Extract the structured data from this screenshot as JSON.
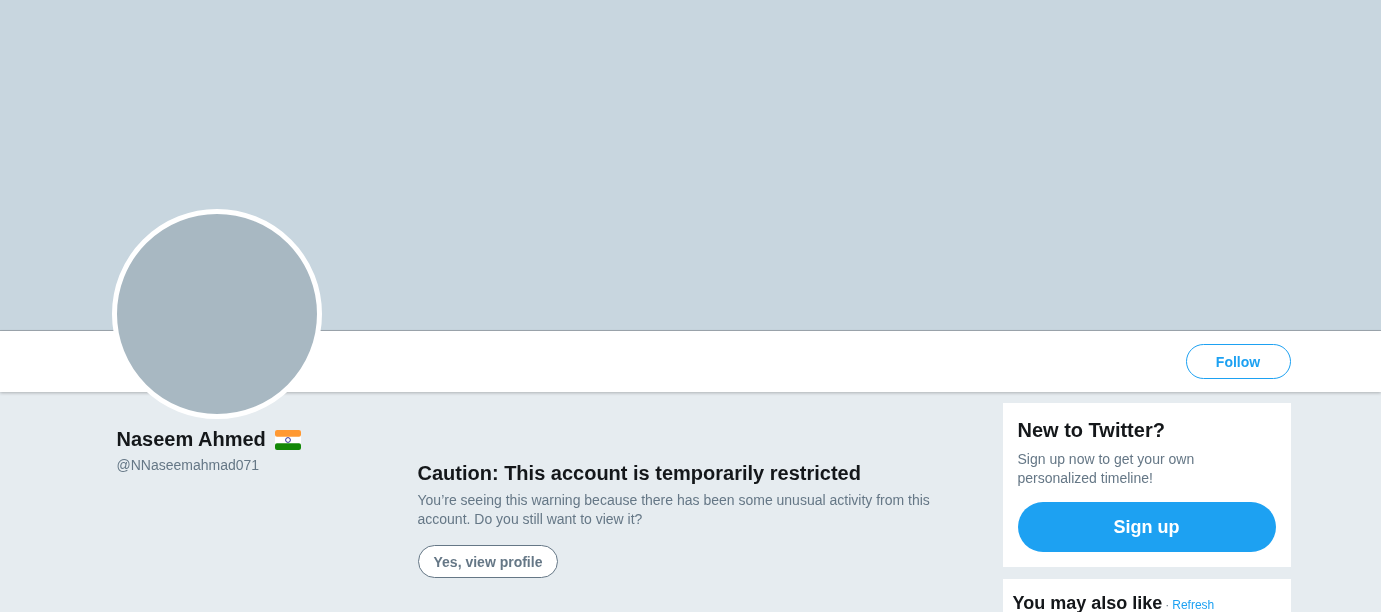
{
  "profile": {
    "name": "Naseem Ahmed",
    "handle": "@NNaseemahmad071"
  },
  "nav": {
    "follow_label": "Follow"
  },
  "warning": {
    "title": "Caution: This account is temporarily restricted",
    "message": "You’re seeing this warning because there has been some unusual activity from this account. Do you still want to view it?",
    "button": "Yes, view profile"
  },
  "signup_card": {
    "title": "New to Twitter?",
    "text": "Sign up now to get your own personalized timeline!",
    "button": "Sign up"
  },
  "suggestions": {
    "title": "You may also like",
    "separator": "·",
    "refresh": "Refresh"
  }
}
